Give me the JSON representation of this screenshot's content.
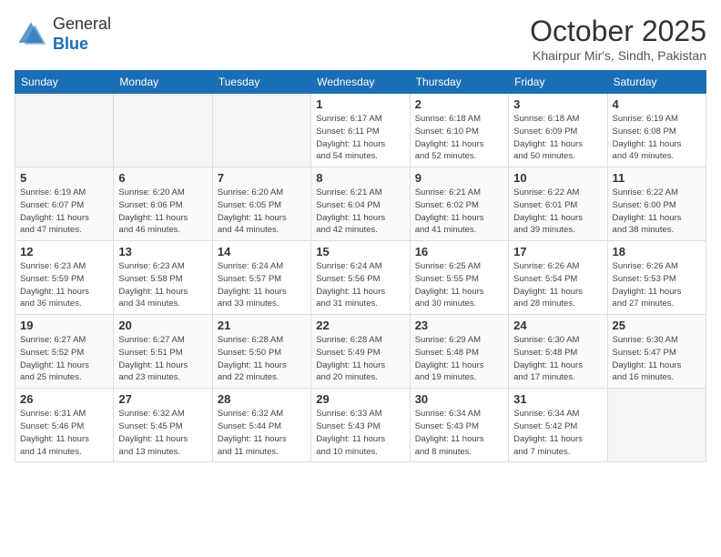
{
  "logo": {
    "general": "General",
    "blue": "Blue"
  },
  "header": {
    "month": "October 2025",
    "location": "Khairpur Mir's, Sindh, Pakistan"
  },
  "weekdays": [
    "Sunday",
    "Monday",
    "Tuesday",
    "Wednesday",
    "Thursday",
    "Friday",
    "Saturday"
  ],
  "weeks": [
    [
      {
        "day": "",
        "info": ""
      },
      {
        "day": "",
        "info": ""
      },
      {
        "day": "",
        "info": ""
      },
      {
        "day": "1",
        "info": "Sunrise: 6:17 AM\nSunset: 6:11 PM\nDaylight: 11 hours\nand 54 minutes."
      },
      {
        "day": "2",
        "info": "Sunrise: 6:18 AM\nSunset: 6:10 PM\nDaylight: 11 hours\nand 52 minutes."
      },
      {
        "day": "3",
        "info": "Sunrise: 6:18 AM\nSunset: 6:09 PM\nDaylight: 11 hours\nand 50 minutes."
      },
      {
        "day": "4",
        "info": "Sunrise: 6:19 AM\nSunset: 6:08 PM\nDaylight: 11 hours\nand 49 minutes."
      }
    ],
    [
      {
        "day": "5",
        "info": "Sunrise: 6:19 AM\nSunset: 6:07 PM\nDaylight: 11 hours\nand 47 minutes."
      },
      {
        "day": "6",
        "info": "Sunrise: 6:20 AM\nSunset: 6:06 PM\nDaylight: 11 hours\nand 46 minutes."
      },
      {
        "day": "7",
        "info": "Sunrise: 6:20 AM\nSunset: 6:05 PM\nDaylight: 11 hours\nand 44 minutes."
      },
      {
        "day": "8",
        "info": "Sunrise: 6:21 AM\nSunset: 6:04 PM\nDaylight: 11 hours\nand 42 minutes."
      },
      {
        "day": "9",
        "info": "Sunrise: 6:21 AM\nSunset: 6:02 PM\nDaylight: 11 hours\nand 41 minutes."
      },
      {
        "day": "10",
        "info": "Sunrise: 6:22 AM\nSunset: 6:01 PM\nDaylight: 11 hours\nand 39 minutes."
      },
      {
        "day": "11",
        "info": "Sunrise: 6:22 AM\nSunset: 6:00 PM\nDaylight: 11 hours\nand 38 minutes."
      }
    ],
    [
      {
        "day": "12",
        "info": "Sunrise: 6:23 AM\nSunset: 5:59 PM\nDaylight: 11 hours\nand 36 minutes."
      },
      {
        "day": "13",
        "info": "Sunrise: 6:23 AM\nSunset: 5:58 PM\nDaylight: 11 hours\nand 34 minutes."
      },
      {
        "day": "14",
        "info": "Sunrise: 6:24 AM\nSunset: 5:57 PM\nDaylight: 11 hours\nand 33 minutes."
      },
      {
        "day": "15",
        "info": "Sunrise: 6:24 AM\nSunset: 5:56 PM\nDaylight: 11 hours\nand 31 minutes."
      },
      {
        "day": "16",
        "info": "Sunrise: 6:25 AM\nSunset: 5:55 PM\nDaylight: 11 hours\nand 30 minutes."
      },
      {
        "day": "17",
        "info": "Sunrise: 6:26 AM\nSunset: 5:54 PM\nDaylight: 11 hours\nand 28 minutes."
      },
      {
        "day": "18",
        "info": "Sunrise: 6:26 AM\nSunset: 5:53 PM\nDaylight: 11 hours\nand 27 minutes."
      }
    ],
    [
      {
        "day": "19",
        "info": "Sunrise: 6:27 AM\nSunset: 5:52 PM\nDaylight: 11 hours\nand 25 minutes."
      },
      {
        "day": "20",
        "info": "Sunrise: 6:27 AM\nSunset: 5:51 PM\nDaylight: 11 hours\nand 23 minutes."
      },
      {
        "day": "21",
        "info": "Sunrise: 6:28 AM\nSunset: 5:50 PM\nDaylight: 11 hours\nand 22 minutes."
      },
      {
        "day": "22",
        "info": "Sunrise: 6:28 AM\nSunset: 5:49 PM\nDaylight: 11 hours\nand 20 minutes."
      },
      {
        "day": "23",
        "info": "Sunrise: 6:29 AM\nSunset: 5:48 PM\nDaylight: 11 hours\nand 19 minutes."
      },
      {
        "day": "24",
        "info": "Sunrise: 6:30 AM\nSunset: 5:48 PM\nDaylight: 11 hours\nand 17 minutes."
      },
      {
        "day": "25",
        "info": "Sunrise: 6:30 AM\nSunset: 5:47 PM\nDaylight: 11 hours\nand 16 minutes."
      }
    ],
    [
      {
        "day": "26",
        "info": "Sunrise: 6:31 AM\nSunset: 5:46 PM\nDaylight: 11 hours\nand 14 minutes."
      },
      {
        "day": "27",
        "info": "Sunrise: 6:32 AM\nSunset: 5:45 PM\nDaylight: 11 hours\nand 13 minutes."
      },
      {
        "day": "28",
        "info": "Sunrise: 6:32 AM\nSunset: 5:44 PM\nDaylight: 11 hours\nand 11 minutes."
      },
      {
        "day": "29",
        "info": "Sunrise: 6:33 AM\nSunset: 5:43 PM\nDaylight: 11 hours\nand 10 minutes."
      },
      {
        "day": "30",
        "info": "Sunrise: 6:34 AM\nSunset: 5:43 PM\nDaylight: 11 hours\nand 8 minutes."
      },
      {
        "day": "31",
        "info": "Sunrise: 6:34 AM\nSunset: 5:42 PM\nDaylight: 11 hours\nand 7 minutes."
      },
      {
        "day": "",
        "info": ""
      }
    ]
  ]
}
